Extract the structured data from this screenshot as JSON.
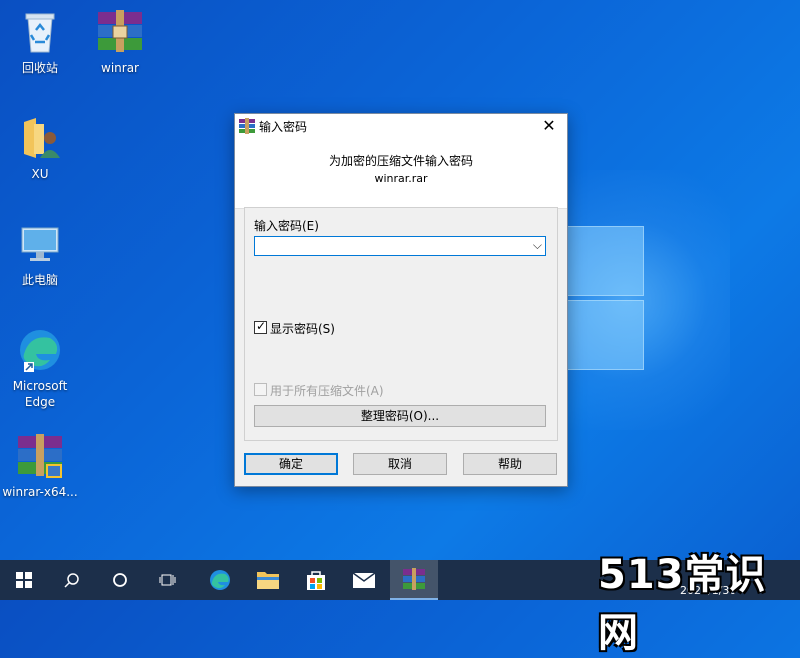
{
  "desktop": {
    "icons": [
      {
        "label": "回收站",
        "icon": "recycle-bin-icon"
      },
      {
        "label": "winrar",
        "icon": "winrar-icon"
      },
      {
        "label": "XU",
        "icon": "user-folder-icon"
      },
      {
        "label": "此电脑",
        "icon": "computer-icon"
      },
      {
        "label": "Microsoft Edge",
        "icon": "edge-icon"
      },
      {
        "label": "winrar-x64...",
        "icon": "winrar-installer-icon"
      }
    ]
  },
  "dialog": {
    "title": "输入密码",
    "header_line1": "为加密的压缩文件输入密码",
    "header_line2": "winrar.rar",
    "password_label": "输入密码(E)",
    "password_value": "",
    "show_password_label": "显示密码(S)",
    "show_password_checked": true,
    "use_for_all_label": "用于所有压缩文件(A)",
    "use_for_all_checked": false,
    "organize_button": "整理密码(O)...",
    "ok_button": "确定",
    "cancel_button": "取消",
    "help_button": "帮助"
  },
  "taskbar": {
    "items": [
      "start-icon",
      "search-icon",
      "cortana-icon",
      "task-view-icon",
      "edge-icon",
      "file-explorer-icon",
      "store-icon",
      "mail-icon",
      "winrar-icon"
    ],
    "clock_date": "2021/1/30"
  },
  "watermark": "513常识网",
  "colors": {
    "accent": "#0078d7",
    "taskbar": "#1c2f4a",
    "dialog_bg": "#f0f0f0"
  }
}
